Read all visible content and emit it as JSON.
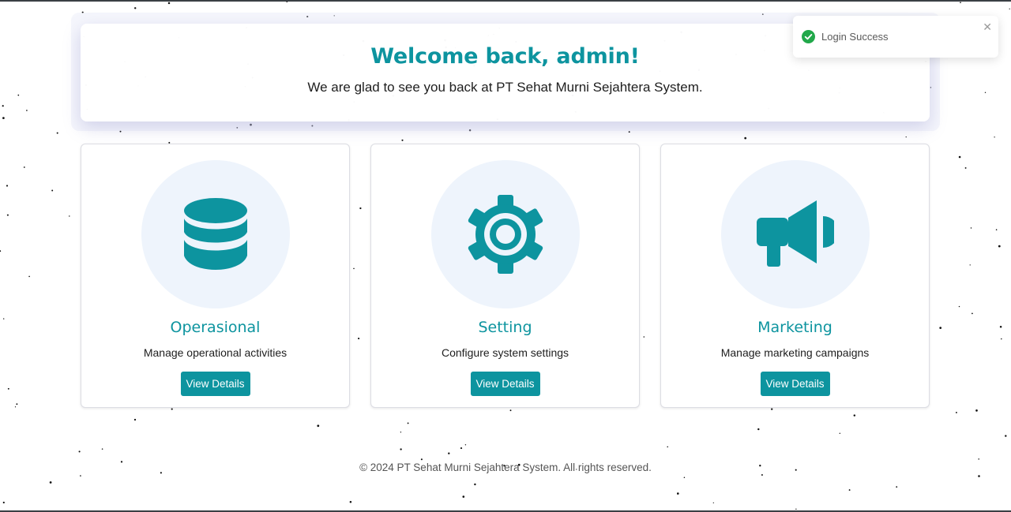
{
  "welcome": {
    "title": "Welcome back, admin!",
    "subtitle": "We are glad to see you back at PT Sehat Murni Sejahtera System."
  },
  "cards": [
    {
      "icon": "database-icon",
      "title": "Operasional",
      "description": "Manage operational activities",
      "button_label": "View Details"
    },
    {
      "icon": "gear-icon",
      "title": "Setting",
      "description": "Configure system settings",
      "button_label": "View Details"
    },
    {
      "icon": "megaphone-icon",
      "title": "Marketing",
      "description": "Manage marketing campaigns",
      "button_label": "View Details"
    }
  ],
  "footer": {
    "text": "© 2024 PT Sehat Murni Sejahtera System. All rights reserved."
  },
  "toast": {
    "message": "Login Success",
    "icon": "check-circle-icon",
    "close_icon": "close-icon"
  },
  "colors": {
    "accent": "#0d949f",
    "icon_circle_bg": "#eef4fc",
    "toast_success": "#21a84a"
  }
}
